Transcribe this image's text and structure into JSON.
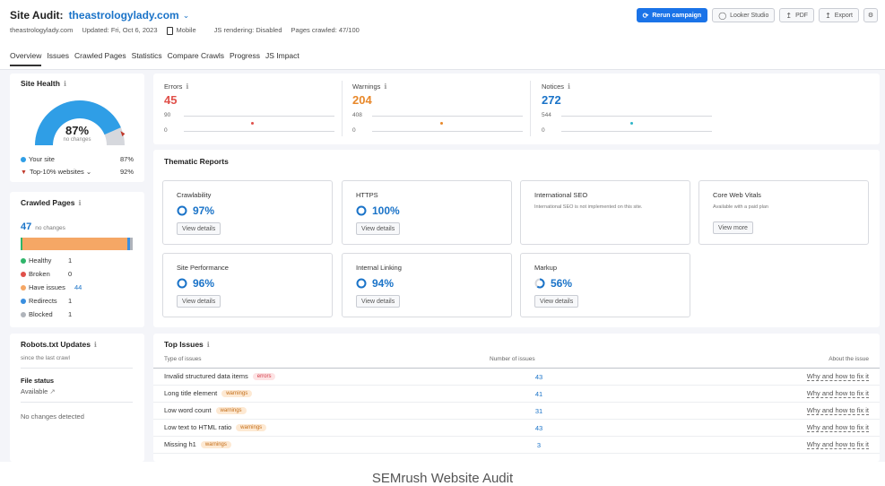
{
  "header": {
    "title_label": "Site Audit:",
    "domain": "theastrologylady.com",
    "meta": {
      "site": "theastrologylady.com",
      "updated": "Updated: Fri, Oct 6, 2023",
      "device": "Mobile",
      "js_rendering": "JS rendering: Disabled",
      "pages_crawled": "Pages crawled: 47/100"
    },
    "actions": {
      "rerun": "Rerun campaign",
      "looker": "Looker Studio",
      "pdf": "PDF",
      "export": "Export"
    }
  },
  "tabs": [
    "Overview",
    "Issues",
    "Crawled Pages",
    "Statistics",
    "Compare Crawls",
    "Progress",
    "JS Impact"
  ],
  "site_health": {
    "title": "Site Health",
    "percent": "87%",
    "percent_value": 87,
    "note": "no changes",
    "your_site_label": "Your site",
    "your_site_value": "87%",
    "top_label": "Top-10% websites",
    "top_value": "92%",
    "colors": {
      "your_site": "#2f9ee6",
      "top": "#c0392b"
    }
  },
  "summary": {
    "errors": {
      "label": "Errors",
      "value": "45",
      "top": "90",
      "bottom": "0",
      "color": "#e0504a"
    },
    "warnings": {
      "label": "Warnings",
      "value": "204",
      "top": "408",
      "bottom": "0",
      "color": "#e8882a"
    },
    "notices": {
      "label": "Notices",
      "value": "272",
      "top": "544",
      "bottom": "0",
      "color": "#1a73c8"
    }
  },
  "thematic": {
    "title": "Thematic Reports",
    "cards": [
      {
        "title": "Crawlability",
        "score": "97%",
        "score_value": 97,
        "button": "View details"
      },
      {
        "title": "HTTPS",
        "score": "100%",
        "score_value": 100,
        "button": "View details"
      },
      {
        "title": "International SEO",
        "subtitle": "International SEO is not implemented on this site."
      },
      {
        "title": "Core Web Vitals",
        "subtitle": "Available with a paid plan",
        "button": "View more"
      },
      {
        "title": "Site Performance",
        "score": "96%",
        "score_value": 96,
        "button": "View details"
      },
      {
        "title": "Internal Linking",
        "score": "94%",
        "score_value": 94,
        "button": "View details"
      },
      {
        "title": "Markup",
        "score": "56%",
        "score_value": 56,
        "button": "View details"
      }
    ]
  },
  "crawled_pages": {
    "title": "Crawled Pages",
    "count": "47",
    "note": "no changes",
    "rows": [
      {
        "label": "Healthy",
        "value": "1",
        "color": "#2fb56a"
      },
      {
        "label": "Broken",
        "value": "0",
        "color": "#e0504a"
      },
      {
        "label": "Have issues",
        "value": "44",
        "color": "#f5a765"
      },
      {
        "label": "Redirects",
        "value": "1",
        "color": "#3a8fe0"
      },
      {
        "label": "Blocked",
        "value": "1",
        "color": "#b0b4bb"
      }
    ]
  },
  "robots": {
    "title": "Robots.txt Updates",
    "sub": "since the last crawl",
    "file_status_label": "File status",
    "file_status_value": "Available",
    "no_changes": "No changes detected"
  },
  "top_issues": {
    "title": "Top Issues",
    "columns": {
      "type": "Type of issues",
      "number": "Number of issues",
      "about": "About the issue"
    },
    "rows": [
      {
        "name": "Invalid structured data items",
        "tag": "errors",
        "count": "43",
        "link": "Why and how to fix it"
      },
      {
        "name": "Long title element",
        "tag": "warnings",
        "count": "41",
        "link": "Why and how to fix it"
      },
      {
        "name": "Low word count",
        "tag": "warnings",
        "count": "31",
        "link": "Why and how to fix it"
      },
      {
        "name": "Low text to HTML ratio",
        "tag": "warnings",
        "count": "43",
        "link": "Why and how to fix it"
      },
      {
        "name": "Missing h1",
        "tag": "warnings",
        "count": "3",
        "link": "Why and how to fix it"
      }
    ]
  },
  "caption": "SEMrush Website Audit"
}
